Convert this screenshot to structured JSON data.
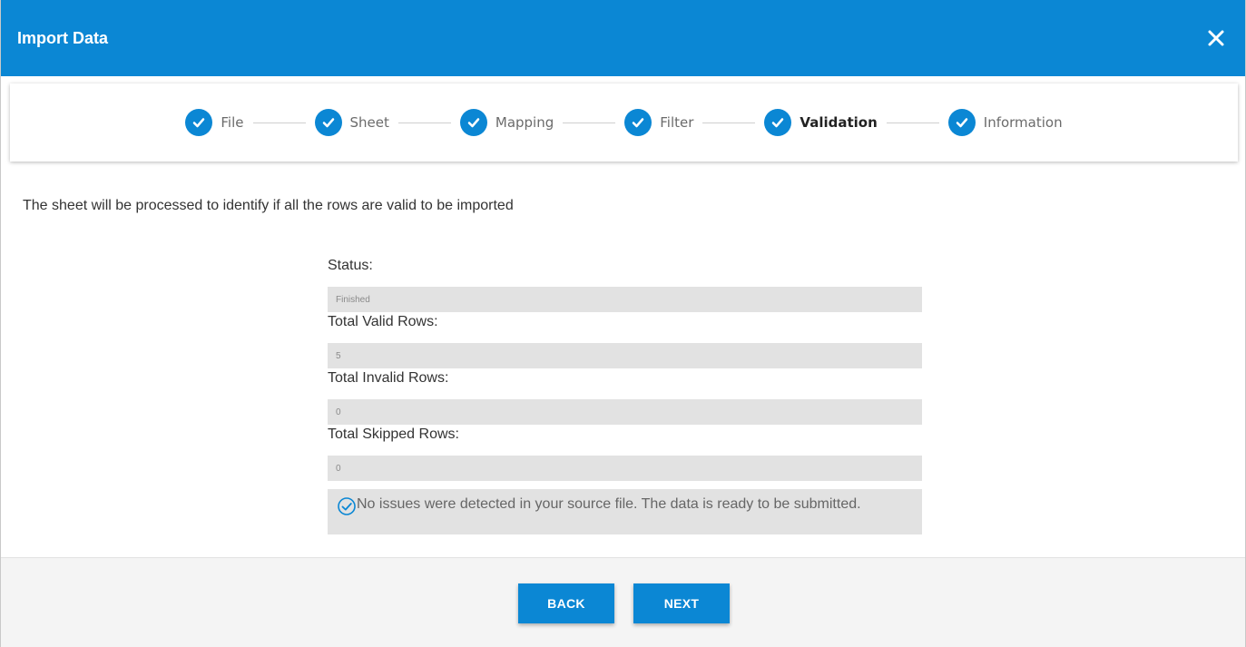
{
  "dialog": {
    "title": "Import Data",
    "close_icon": "close-icon"
  },
  "stepper": {
    "steps": [
      {
        "label": "File",
        "state": "complete"
      },
      {
        "label": "Sheet",
        "state": "complete"
      },
      {
        "label": "Mapping",
        "state": "complete"
      },
      {
        "label": "Filter",
        "state": "complete"
      },
      {
        "label": "Validation",
        "state": "active"
      },
      {
        "label": "Information",
        "state": "complete"
      }
    ]
  },
  "main": {
    "description": "The sheet will be processed to identify if all the rows are valid to be imported",
    "fields": [
      {
        "label": "Status:",
        "value": "Finished"
      },
      {
        "label": "Total Valid Rows:",
        "value": "5"
      },
      {
        "label": "Total Invalid Rows:",
        "value": "0"
      },
      {
        "label": "Total Skipped Rows:",
        "value": "0"
      }
    ],
    "message": "No issues were detected in your source file. The data is ready to be submitted."
  },
  "footer": {
    "back_label": "BACK",
    "next_label": "NEXT"
  },
  "colors": {
    "accent": "#0b87d4",
    "field_bg": "#e2e2e2",
    "footer_bg": "#f4f4f4"
  }
}
